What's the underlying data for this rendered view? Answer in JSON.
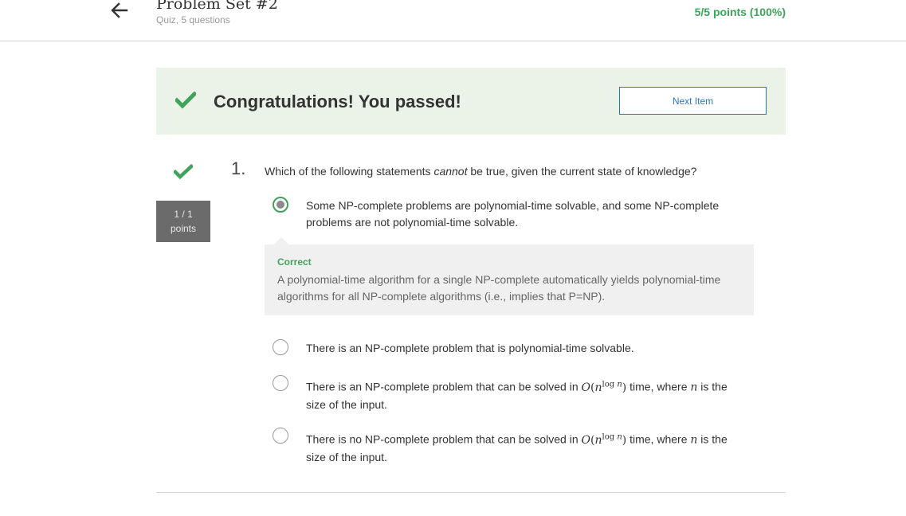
{
  "header": {
    "title": "Problem Set #2",
    "subtitle": "Quiz, 5 questions",
    "score": "5/5 points (100%)",
    "back_icon": "arrow-left-icon"
  },
  "banner": {
    "message": "Congratulations! You passed!",
    "next_label": "Next Item",
    "icon": "checkmark-icon"
  },
  "question": {
    "number": "1.",
    "text_before": "Which of the following statements ",
    "text_emphasis": "cannot",
    "text_after": " be true, given the current state of knowledge?",
    "points_line1": "1 / 1",
    "points_line2": "points",
    "options": [
      {
        "text": "Some NP-complete problems are polynomial-time solvable, and some NP-complete problems are not polynomial-time solvable.",
        "selected": true
      },
      {
        "text": "There is an NP-complete problem that is polynomial-time solvable.",
        "selected": false
      },
      {
        "text_before": "There is an NP-complete problem that can be solved in ",
        "math_O": "O",
        "math_open": "(",
        "math_n": "n",
        "math_sup_log": "log",
        "math_sup_n": "n",
        "math_close": ")",
        "text_mid": " time, where ",
        "math_var": "n",
        "text_after": " is the size of the input.",
        "selected": false
      },
      {
        "text_before": "There is no NP-complete problem that can be solved in ",
        "math_O": "O",
        "math_open": "(",
        "math_n": "n",
        "math_sup_log": "log",
        "math_sup_n": "n",
        "math_close": ")",
        "text_mid": " time, where ",
        "math_var": "n",
        "text_after": " is the size of the input.",
        "selected": false
      }
    ],
    "feedback": {
      "title": "Correct",
      "text": "A polynomial-time algorithm for a single NP-complete automatically yields polynomial-time algorithms for all NP-complete algorithms (i.e., implies that P=NP)."
    }
  },
  "colors": {
    "success": "#3fa45a",
    "link": "#2a73cc",
    "banner_bg": "#ebf3e8",
    "points_bg": "#6b6b6b"
  }
}
